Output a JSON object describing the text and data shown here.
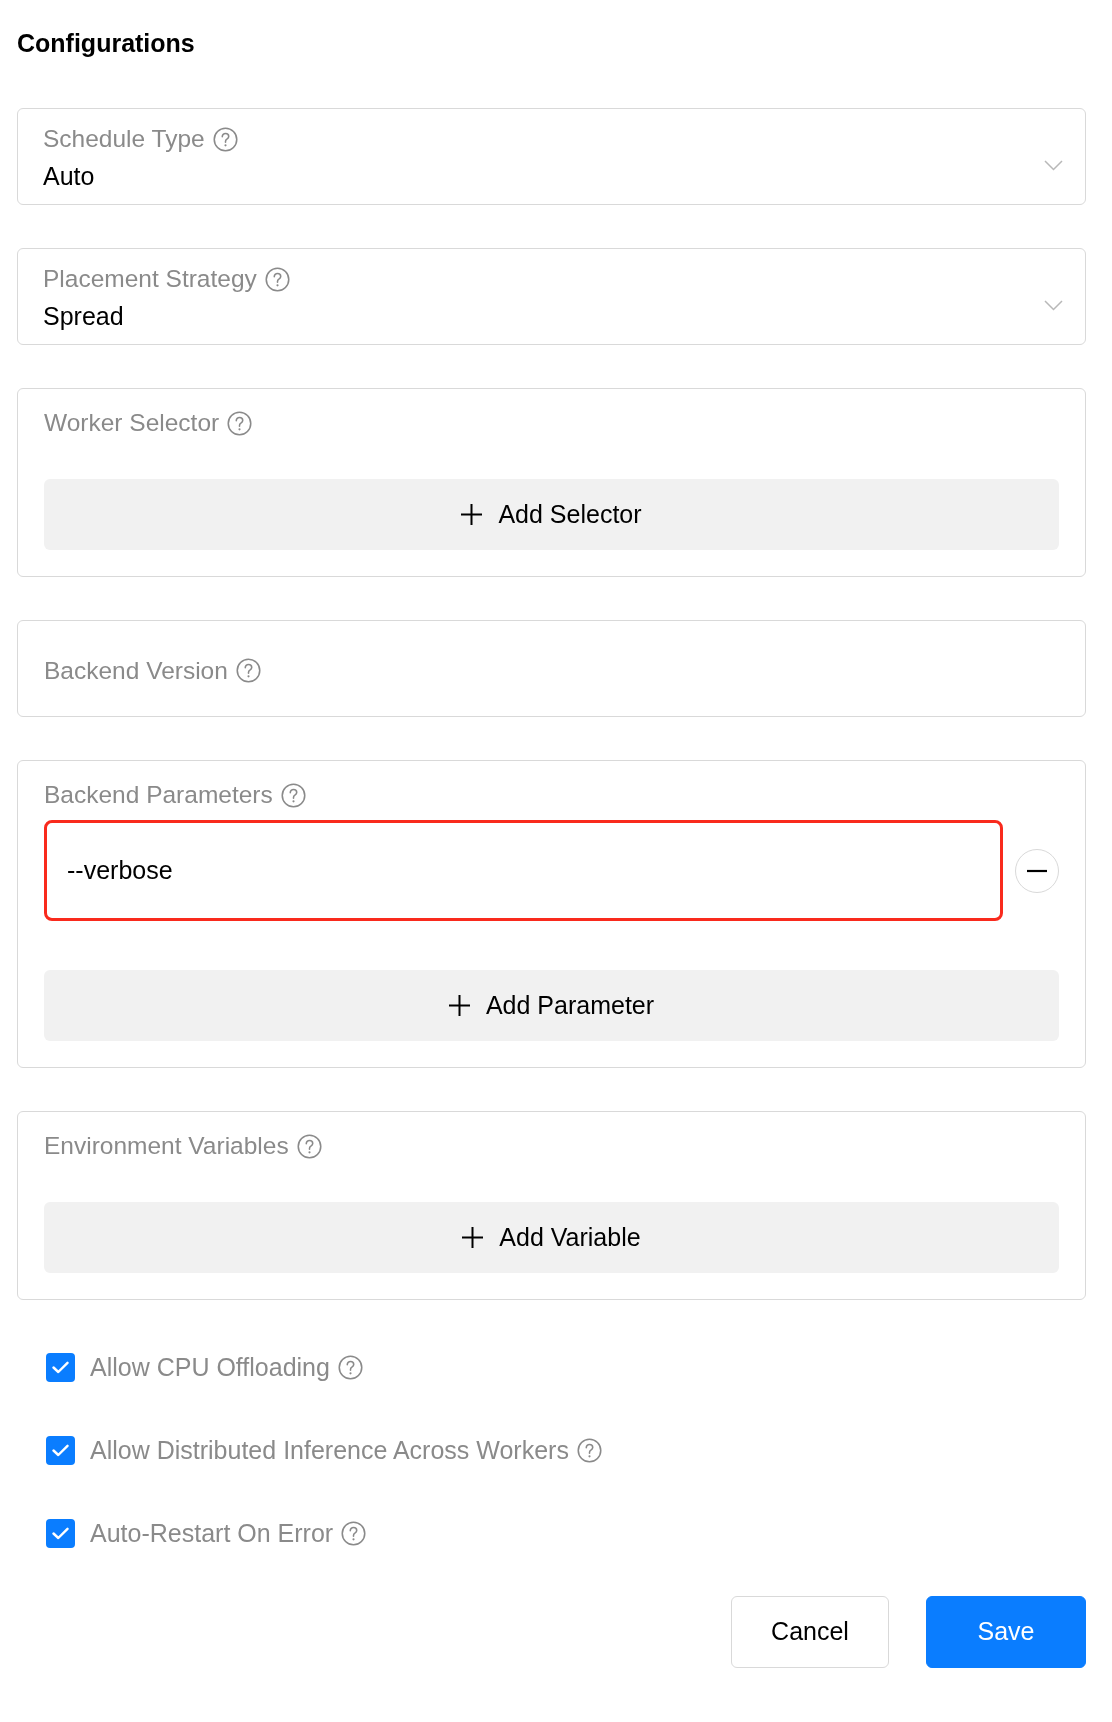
{
  "title": "Configurations",
  "fields": [
    {
      "kind": "select",
      "label": "Schedule Type",
      "value": "Auto"
    },
    {
      "kind": "select",
      "label": "Placement Strategy",
      "value": "Spread"
    },
    {
      "kind": "list",
      "label": "Worker Selector",
      "add_button": "Add Selector"
    },
    {
      "kind": "input",
      "label": "Backend Version"
    },
    {
      "kind": "list",
      "label": "Backend Parameters",
      "items": [
        {
          "value": "--verbose",
          "highlighted": true
        }
      ],
      "add_button": "Add Parameter"
    },
    {
      "kind": "list",
      "label": "Environment Variables",
      "add_button": "Add Variable"
    }
  ],
  "options": [
    {
      "label": "Allow CPU Offloading",
      "checked": true
    },
    {
      "label": "Allow Distributed Inference Across Workers",
      "checked": true
    },
    {
      "label": "Auto-Restart On Error",
      "checked": true
    }
  ],
  "buttons": [
    {
      "label": "Cancel",
      "kind": "default"
    },
    {
      "label": "Save",
      "kind": "primary"
    }
  ]
}
